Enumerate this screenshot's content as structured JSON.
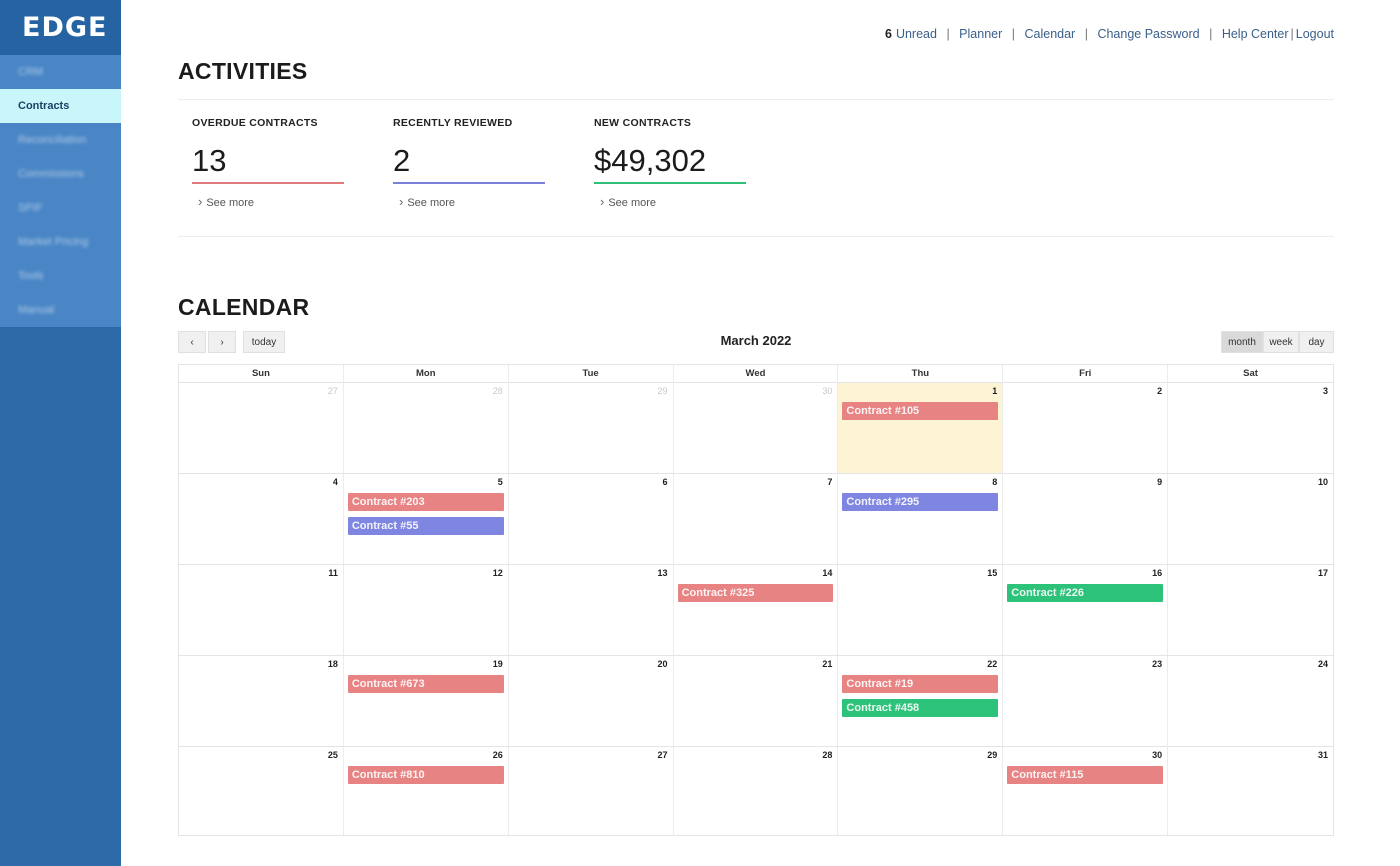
{
  "app": {
    "logo": "EDGE"
  },
  "sidebar": {
    "items": [
      {
        "label": "CRM",
        "active": false
      },
      {
        "label": "Contracts",
        "active": true
      },
      {
        "label": "Reconciliation",
        "active": false
      },
      {
        "label": "Commissions",
        "active": false
      },
      {
        "label": "SPIF",
        "active": false
      },
      {
        "label": "Market Pricing",
        "active": false
      },
      {
        "label": "Tools",
        "active": false
      },
      {
        "label": "Manual",
        "active": false
      }
    ]
  },
  "header": {
    "unread_count": "6",
    "unread_label": "Unread",
    "links": [
      "Planner",
      "Calendar",
      "Change Password",
      "Help Center"
    ],
    "logout": "Logout"
  },
  "activities": {
    "title": "ACTIVITIES",
    "stats": [
      {
        "label": "OVERDUE CONTRACTS",
        "value": "13",
        "more": "See more",
        "color": "#e07b7b"
      },
      {
        "label": "RECENTLY REVIEWED",
        "value": "2",
        "more": "See more",
        "color": "#7a7fd8"
      },
      {
        "label": "NEW CONTRACTS",
        "value": "$49,302",
        "more": "See more",
        "color": "#2fbf77"
      }
    ]
  },
  "calendar": {
    "title": "CALENDAR",
    "month_title": "March 2022",
    "today_label": "today",
    "prev_icon": "chevron-left-icon",
    "next_icon": "chevron-right-icon",
    "views": [
      "month",
      "week",
      "day"
    ],
    "active_view": "month",
    "weekdays": [
      "Sun",
      "Mon",
      "Tue",
      "Wed",
      "Thu",
      "Fri",
      "Sat"
    ],
    "colors": {
      "red": "#e88383",
      "blue": "#7f86e2",
      "green": "#2dc27a",
      "today_bg": "#fdf4d6"
    },
    "weeks": [
      [
        {
          "day": "27",
          "other": true,
          "events": []
        },
        {
          "day": "28",
          "other": true,
          "events": []
        },
        {
          "day": "29",
          "other": true,
          "events": []
        },
        {
          "day": "30",
          "other": true,
          "events": []
        },
        {
          "day": "1",
          "other": false,
          "today": true,
          "events": [
            {
              "title": "Contract #105",
              "color": "red"
            }
          ]
        },
        {
          "day": "2",
          "other": false,
          "events": []
        },
        {
          "day": "3",
          "other": false,
          "events": []
        }
      ],
      [
        {
          "day": "4",
          "other": false,
          "events": []
        },
        {
          "day": "5",
          "other": false,
          "events": [
            {
              "title": "Contract #203",
              "color": "red"
            },
            {
              "title": "Contract #55",
              "color": "blue"
            }
          ]
        },
        {
          "day": "6",
          "other": false,
          "events": []
        },
        {
          "day": "7",
          "other": false,
          "events": []
        },
        {
          "day": "8",
          "other": false,
          "events": [
            {
              "title": "Contract #295",
              "color": "blue"
            }
          ]
        },
        {
          "day": "9",
          "other": false,
          "events": []
        },
        {
          "day": "10",
          "other": false,
          "events": []
        }
      ],
      [
        {
          "day": "11",
          "other": false,
          "events": []
        },
        {
          "day": "12",
          "other": false,
          "events": []
        },
        {
          "day": "13",
          "other": false,
          "events": []
        },
        {
          "day": "14",
          "other": false,
          "events": [
            {
              "title": "Contract #325",
              "color": "red"
            }
          ]
        },
        {
          "day": "15",
          "other": false,
          "events": []
        },
        {
          "day": "16",
          "other": false,
          "events": [
            {
              "title": "Contract #226",
              "color": "green"
            }
          ]
        },
        {
          "day": "17",
          "other": false,
          "events": []
        }
      ],
      [
        {
          "day": "18",
          "other": false,
          "events": []
        },
        {
          "day": "19",
          "other": false,
          "events": [
            {
              "title": "Contract #673",
              "color": "red"
            }
          ]
        },
        {
          "day": "20",
          "other": false,
          "events": []
        },
        {
          "day": "21",
          "other": false,
          "events": []
        },
        {
          "day": "22",
          "other": false,
          "events": [
            {
              "title": "Contract #19",
              "color": "red"
            },
            {
              "title": "Contract #458",
              "color": "green"
            }
          ]
        },
        {
          "day": "23",
          "other": false,
          "events": []
        },
        {
          "day": "24",
          "other": false,
          "events": []
        }
      ],
      [
        {
          "day": "25",
          "other": false,
          "events": []
        },
        {
          "day": "26",
          "other": false,
          "events": [
            {
              "title": "Contract #810",
              "color": "red"
            }
          ]
        },
        {
          "day": "27",
          "other": false,
          "events": []
        },
        {
          "day": "28",
          "other": false,
          "events": []
        },
        {
          "day": "29",
          "other": false,
          "events": []
        },
        {
          "day": "30",
          "other": false,
          "events": [
            {
              "title": "Contract #115",
              "color": "red"
            }
          ]
        },
        {
          "day": "31",
          "other": false,
          "events": []
        }
      ]
    ]
  }
}
